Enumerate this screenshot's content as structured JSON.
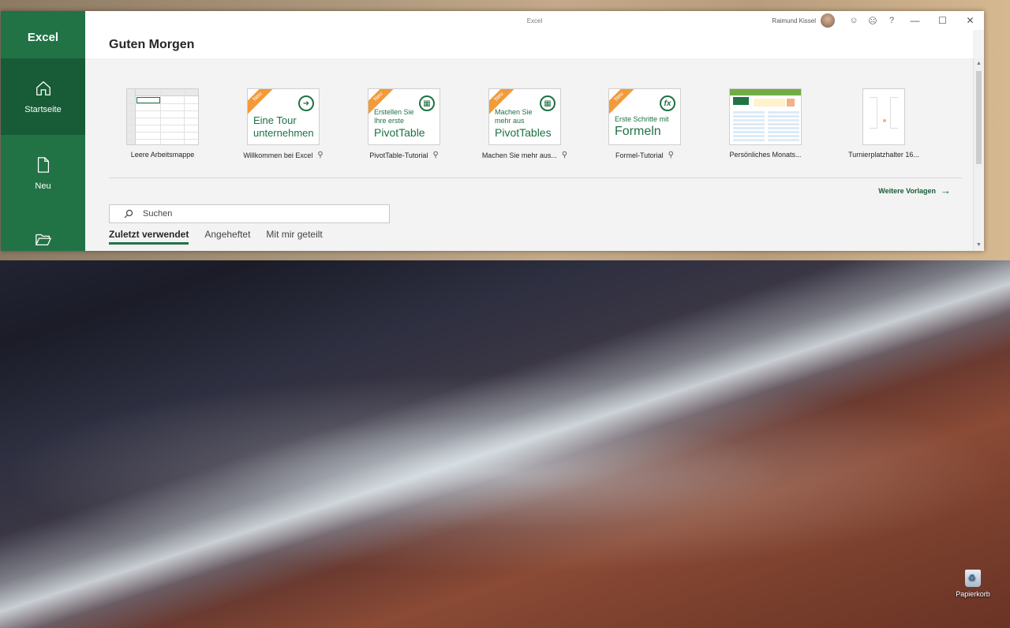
{
  "window": {
    "title": "Excel",
    "user_name": "Raimund Kissel",
    "help": "?"
  },
  "sidebar": {
    "app_name": "Excel",
    "items": [
      {
        "label": "Startseite",
        "icon": "home-icon"
      },
      {
        "label": "Neu",
        "icon": "new-file-icon"
      },
      {
        "label": "",
        "icon": "open-folder-icon"
      }
    ]
  },
  "main": {
    "greeting": "Guten Morgen",
    "templates": [
      {
        "label": "Leere Arbeitsmappe",
        "pinnable": false
      },
      {
        "label": "Willkommen bei Excel",
        "badge": "Neu",
        "thumb_text": [
          "Eine Tour",
          "unternehmen"
        ],
        "pinnable": true
      },
      {
        "label": "PivotTable-Tutorial",
        "badge": "Neu",
        "thumb_text": [
          "Erstellen Sie",
          "Ihre erste",
          "PivotTable"
        ],
        "pinnable": true
      },
      {
        "label": "Machen Sie mehr aus...",
        "badge": "Neu",
        "thumb_text": [
          "Machen Sie",
          "mehr aus",
          "PivotTables"
        ],
        "pinnable": true
      },
      {
        "label": "Formel-Tutorial",
        "badge": "Neu",
        "thumb_text": [
          "Erste Schritte mit",
          "Formeln"
        ],
        "pinnable": true
      },
      {
        "label": "Persönliches Monats...",
        "pinnable": false
      },
      {
        "label": "Turnierplatzhalter 16...",
        "pinnable": false
      }
    ],
    "more_templates": "Weitere Vorlagen",
    "search_placeholder": "Suchen",
    "tabs": [
      "Zuletzt verwendet",
      "Angeheftet",
      "Mit mir geteilt"
    ]
  },
  "desktop": {
    "recycle_bin": "Papierkorb"
  },
  "colors": {
    "accent": "#217346",
    "accent_dark": "#185c37",
    "badge": "#f29b38"
  }
}
